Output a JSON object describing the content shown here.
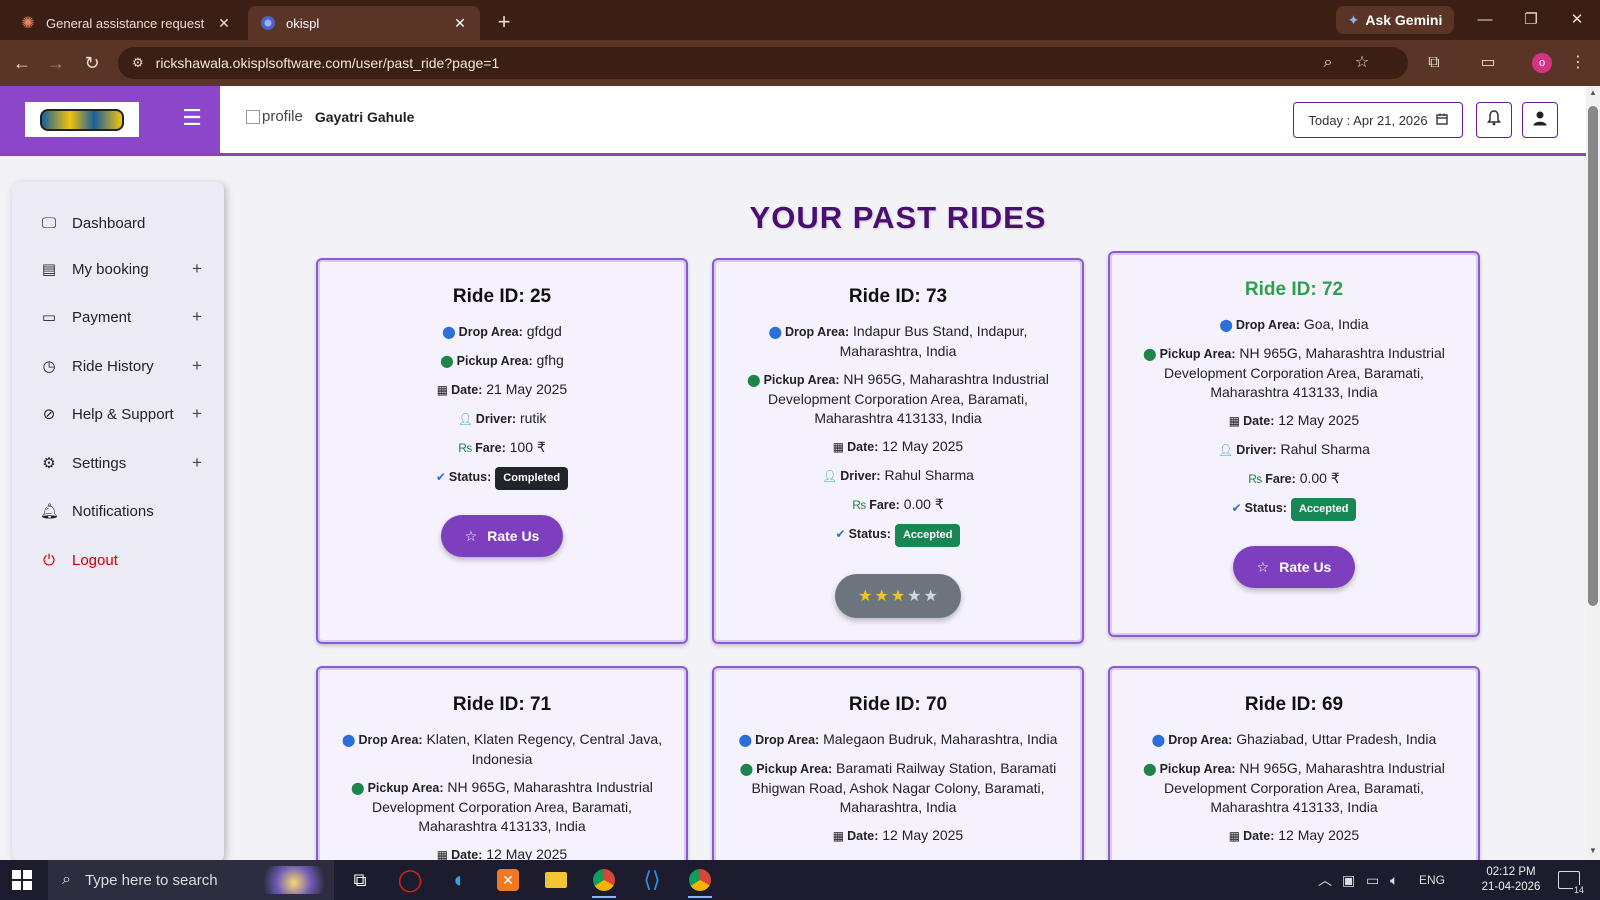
{
  "browser": {
    "tabs": [
      {
        "title": "General assistance request - Cla",
        "icon": "claude-icon"
      },
      {
        "title": "okispl",
        "icon": "globe-icon"
      }
    ],
    "gemini_label": "Ask Gemini",
    "url": "rickshawala.okisplsoftware.com/user/past_ride?page=1",
    "profile_initial": "o"
  },
  "header": {
    "profile_alt": "profile",
    "username": "Gayatri Gahule",
    "today_label": "Today : Apr 21, 2026"
  },
  "sidebar": {
    "items": [
      {
        "label": "Dashboard",
        "icon": "monitor-icon",
        "expandable": false
      },
      {
        "label": "My booking",
        "icon": "clipboard-icon",
        "expandable": true
      },
      {
        "label": "Payment",
        "icon": "credit-card-icon",
        "expandable": true
      },
      {
        "label": "Ride History",
        "icon": "clock-icon",
        "expandable": true
      },
      {
        "label": "Help & Support",
        "icon": "compass-icon",
        "expandable": true
      },
      {
        "label": "Settings",
        "icon": "gear-icon",
        "expandable": true
      },
      {
        "label": "Notifications",
        "icon": "bell-icon",
        "expandable": false
      },
      {
        "label": "Logout",
        "icon": "power-icon",
        "expandable": false
      }
    ]
  },
  "main": {
    "title": "YOUR PAST RIDES",
    "labels": {
      "drop": "Drop Area:",
      "pickup": "Pickup Area:",
      "date": "Date:",
      "driver": "Driver:",
      "fare": "Fare:",
      "status": "Status:",
      "rate": "Rate Us"
    },
    "rides": [
      {
        "title": "Ride ID: 25",
        "drop": "gfdgd",
        "pickup": "gfhg",
        "date": "21 May 2025",
        "driver": "rutik",
        "fare": "100 ₹",
        "status": "Completed"
      },
      {
        "title": "Ride ID: 73",
        "drop": "Indapur Bus Stand, Indapur, Maharashtra, India",
        "pickup": "NH 965G, Maharashtra Industrial Development Corporation Area, Baramati, Maharashtra 413133, India",
        "date": "12 May 2025",
        "driver": "Rahul Sharma",
        "fare": "0.00 ₹",
        "status": "Accepted",
        "rating": 3
      },
      {
        "title": "Ride ID: 72",
        "drop": "Goa, India",
        "pickup": "NH 965G, Maharashtra Industrial Development Corporation Area, Baramati, Maharashtra 413133, India",
        "date": "12 May 2025",
        "driver": "Rahul Sharma",
        "fare": "0.00 ₹",
        "status": "Accepted"
      },
      {
        "title": "Ride ID: 71",
        "drop": "Klaten, Klaten Regency, Central Java, Indonesia",
        "pickup": "NH 965G, Maharashtra Industrial Development Corporation Area, Baramati, Maharashtra 413133, India",
        "date": "12 May 2025"
      },
      {
        "title": "Ride ID: 70",
        "drop": "Malegaon Budruk, Maharashtra, India",
        "pickup": "Baramati Railway Station, Baramati Bhigwan Road, Ashok Nagar Colony, Baramati, Maharashtra, India",
        "date": "12 May 2025"
      },
      {
        "title": "Ride ID: 69",
        "drop": "Ghaziabad, Uttar Pradesh, India",
        "pickup": "NH 965G, Maharashtra Industrial Development Corporation Area, Baramati, Maharashtra 413133, India",
        "date": "12 May 2025"
      }
    ]
  },
  "taskbar": {
    "search_placeholder": "Type here to search",
    "language": "ENG",
    "time": "02:12 PM",
    "date": "21-04-2026",
    "notification_count": "14"
  },
  "colors": {
    "brand_purple": "#8b46c9",
    "title_purple": "#4a1070",
    "accepted_green": "#198754",
    "completed_dark": "#212529",
    "rate_button": "#7e3fbf"
  }
}
